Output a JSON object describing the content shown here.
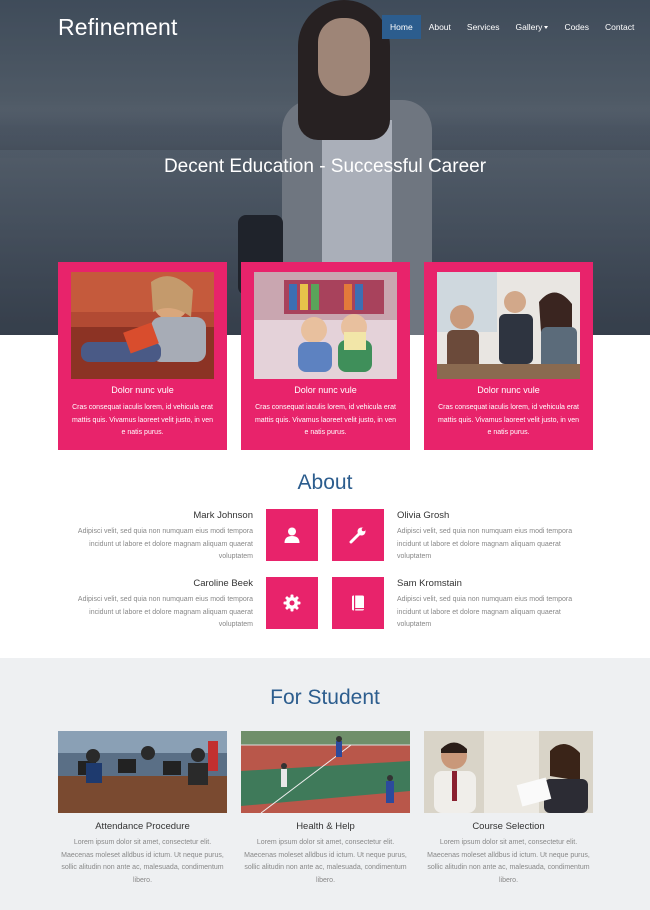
{
  "brand": {
    "logo": "Refinement",
    "accent": "#e8236b",
    "primary": "#2c5d8e"
  },
  "nav": {
    "items": [
      {
        "label": "Home",
        "active": true
      },
      {
        "label": "About"
      },
      {
        "label": "Services"
      },
      {
        "label": "Gallery",
        "dropdown": true
      },
      {
        "label": "Codes"
      },
      {
        "label": "Contact"
      }
    ]
  },
  "hero": {
    "title": "Decent Education - Successful Career"
  },
  "features": [
    {
      "title": "Dolor nunc vule",
      "text": "Cras consequat iaculis lorem, id vehicula erat mattis quis. Vivamus laoreet velit justo, in ven e natis purus."
    },
    {
      "title": "Dolor nunc vule",
      "text": "Cras consequat iaculis lorem, id vehicula erat mattis quis. Vivamus laoreet velit justo, in ven e natis purus."
    },
    {
      "title": "Dolor nunc vule",
      "text": "Cras consequat iaculis lorem, id vehicula erat mattis quis. Vivamus laoreet velit justo, in ven e natis purus."
    }
  ],
  "about": {
    "title": "About",
    "people": [
      {
        "name": "Mark Johnson",
        "text": "Adipisci velit, sed quia non numquam eius modi tempora incidunt ut labore et dolore magnam aliquam quaerat voluptatem",
        "icon": "user-icon"
      },
      {
        "name": "Olivia Grosh",
        "text": "Adipisci velit, sed quia non numquam eius modi tempora incidunt ut labore et dolore magnam aliquam quaerat voluptatem",
        "icon": "wrench-icon"
      },
      {
        "name": "Caroline Beek",
        "text": "Adipisci velit, sed quia non numquam eius modi tempora incidunt ut labore et dolore magnam aliquam quaerat voluptatem",
        "icon": "gear-icon"
      },
      {
        "name": "Sam Kromstain",
        "text": "Adipisci velit, sed quia non numquam eius modi tempora incidunt ut labore et dolore magnam aliquam quaerat voluptatem",
        "icon": "book-icon"
      }
    ]
  },
  "student": {
    "title": "For Student",
    "items": [
      {
        "title": "Attendance Procedure",
        "text": "Lorem ipsum dolor sit amet, consectetur elit. Maecenas moleset alldbus id ictum. Ut neque purus, sollic alitudin non ante ac, malesuada, condimentum libero."
      },
      {
        "title": "Health & Help",
        "text": "Lorem ipsum dolor sit amet, consectetur elit. Maecenas moleset alldbus id ictum. Ut neque purus, sollic alitudin non ante ac, malesuada, condimentum libero."
      },
      {
        "title": "Course Selection",
        "text": "Lorem ipsum dolor sit amet, consectetur elit. Maecenas moleset alldbus id ictum. Ut neque purus, sollic alitudin non ante ac, malesuada, condimentum libero."
      }
    ]
  }
}
